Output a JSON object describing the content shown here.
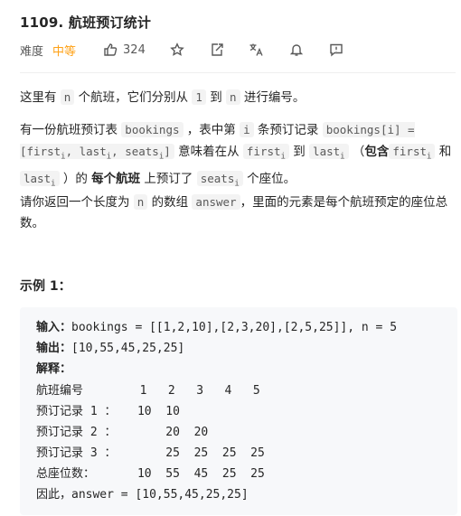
{
  "problem": {
    "title": "1109. 航班预订统计",
    "difficulty_label": "难度",
    "difficulty": "中等",
    "likes": "324",
    "colors": {
      "difficulty": "#ffa116"
    }
  },
  "icons": [
    "thumbs-up-icon",
    "star-icon",
    "share-icon",
    "translate-icon",
    "bell-icon",
    "feedback-icon"
  ],
  "description": {
    "p1": {
      "t1": "这里有 ",
      "c1": "n",
      "t2": " 个航班，它们分别从 ",
      "c2": "1",
      "t3": " 到 ",
      "c3": "n",
      "t4": " 进行编号。"
    },
    "p2": {
      "t1": "有一份航班预订表 ",
      "c1": "bookings",
      "t2": " ，表中第 ",
      "c2": "i",
      "t3": " 条预订记录 ",
      "c3": "bookings[i] = [first",
      "c3sub1": "i",
      "c3b": ", last",
      "c3sub2": "i",
      "c3c": ", seats",
      "c3sub3": "i",
      "c3d": "]",
      "t4": " 意味着在从 ",
      "c4": "first",
      "c4sub": "i",
      "t5": " 到 ",
      "c5": "last",
      "c5sub": "i",
      "t6": " （",
      "b1": "包含",
      "c6": "first",
      "c6sub": "i",
      "t7": " 和 ",
      "c7": "last",
      "c7sub": "i",
      "t8": " ）的 ",
      "b2": "每个航班",
      "t9": " 上预订了 ",
      "c8": "seats",
      "c8sub": "i",
      "t10": " 个座位。"
    },
    "p3": {
      "t1": "请你返回一个长度为 ",
      "c1": "n",
      "t2": " 的数组 ",
      "c2": "answer",
      "t3": "，里面的元素是每个航班预定的座位总数。"
    }
  },
  "example": {
    "title": "示例 1：",
    "input_label": "输入：",
    "input_value": "bookings = [[1,2,10],[2,3,20],[2,5,25]], n = 5",
    "output_label": "输出：",
    "output_value": "[10,55,45,25,25]",
    "explain_label": "解释：",
    "rows": [
      "航班编号        1   2   3   4   5",
      "预订记录 1 ：   10  10",
      "预订记录 2 ：       20  20",
      "预订记录 3 ：       25  25  25  25",
      "总座位数：      10  55  45  25  25",
      "因此，answer = [10,55,45,25,25]"
    ]
  }
}
